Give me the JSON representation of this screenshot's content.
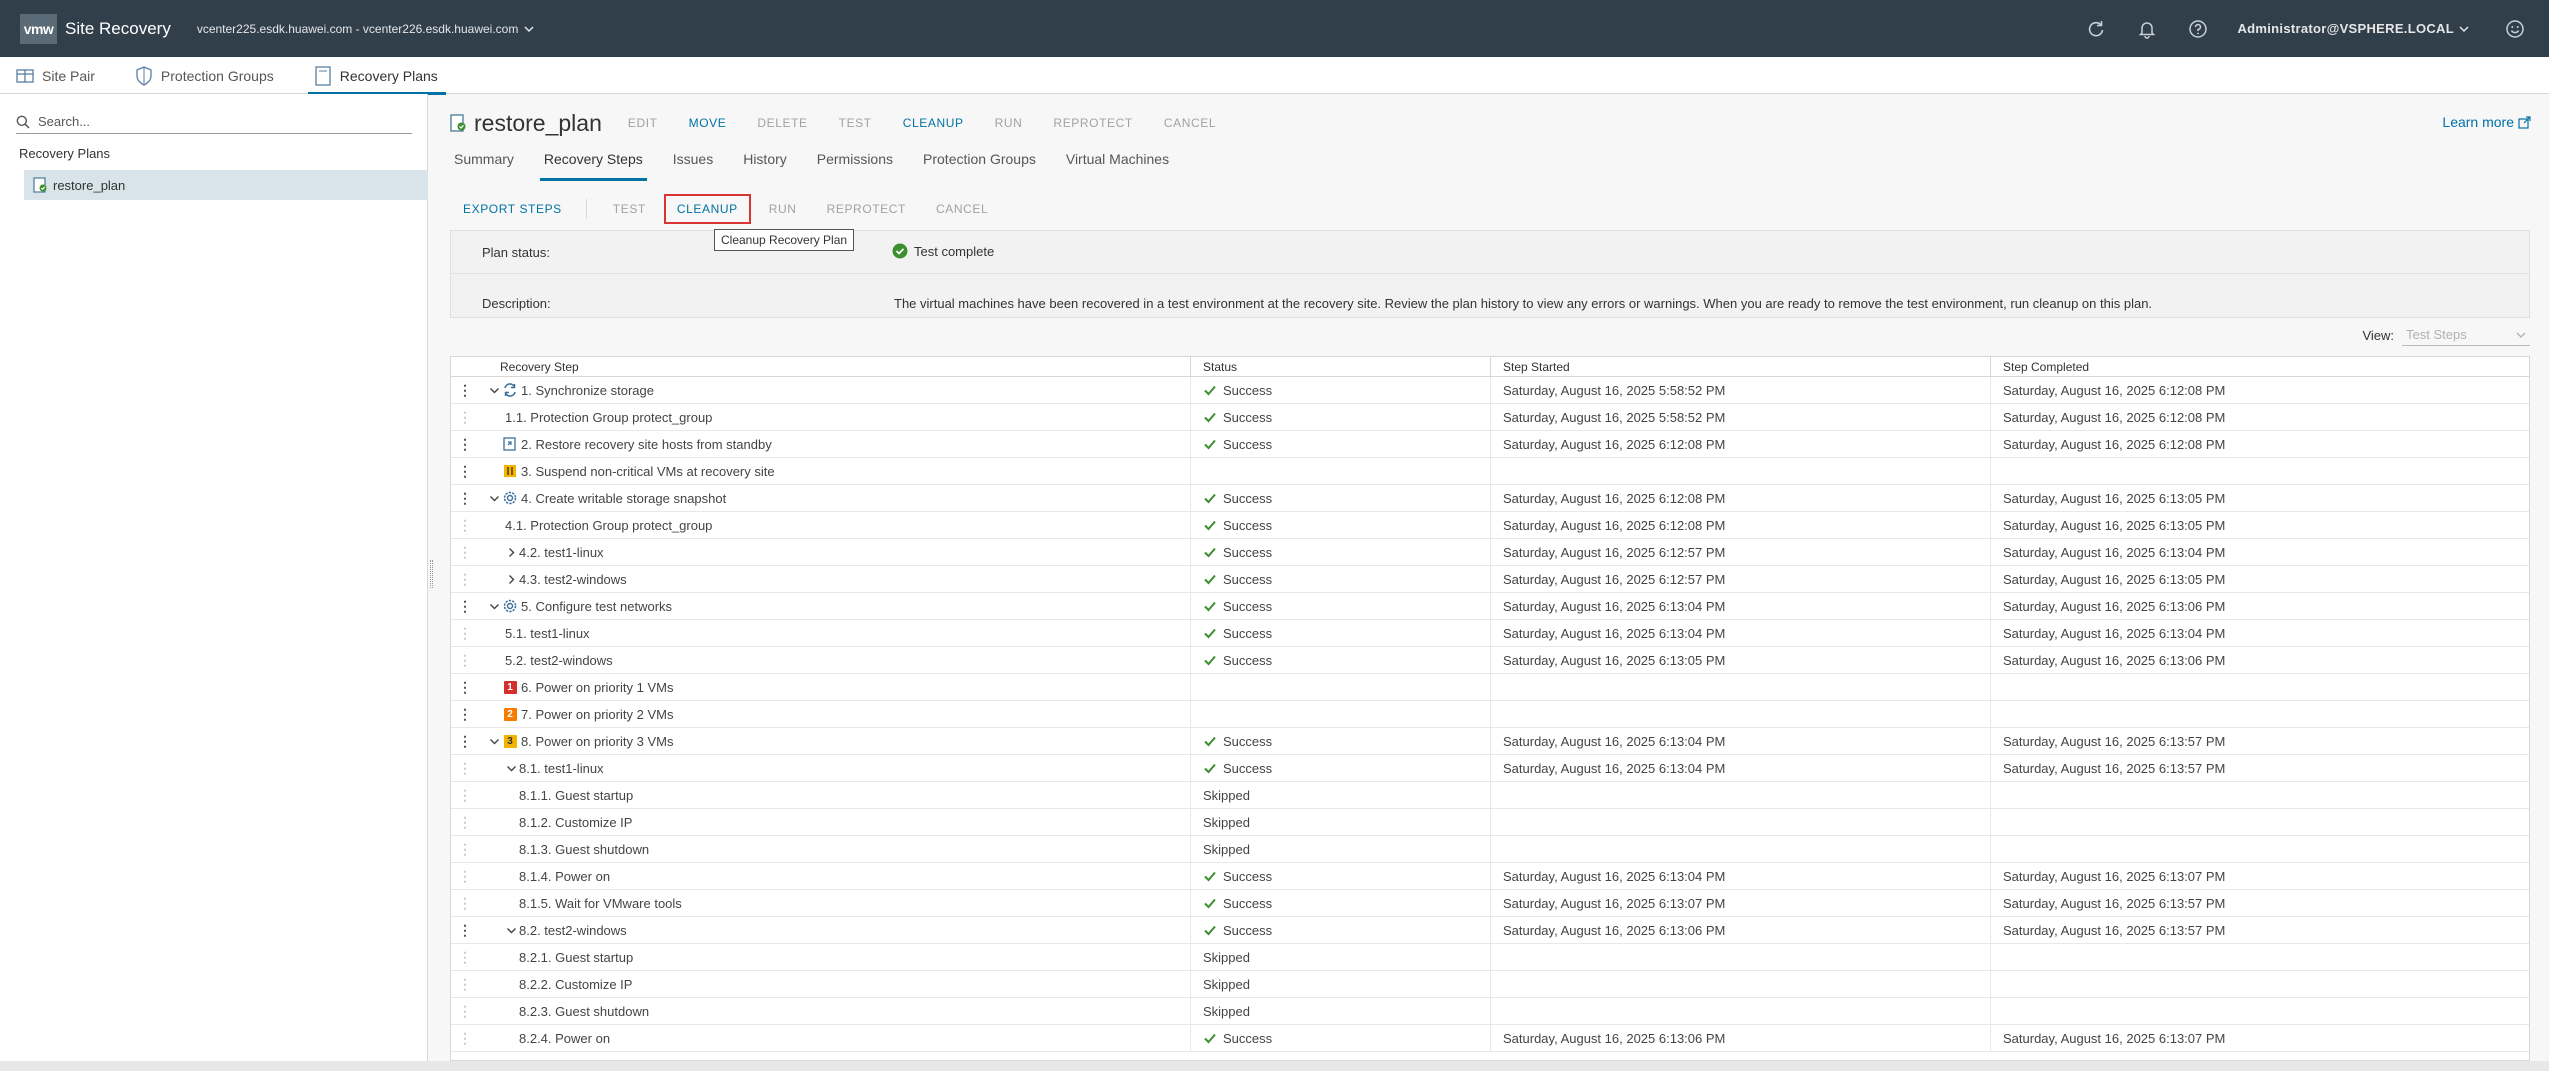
{
  "header": {
    "logo_text": "vmw",
    "app_title": "Site Recovery",
    "vcenter_pair": "vcenter225.esdk.huawei.com - vcenter226.esdk.huawei.com",
    "user": "Administrator@VSPHERE.LOCAL",
    "icons": [
      "refresh-icon",
      "bell-icon",
      "help-icon",
      "smiley-icon"
    ]
  },
  "nav": {
    "items": [
      {
        "label": "Site Pair",
        "icon": "site-pair-icon"
      },
      {
        "label": "Protection Groups",
        "icon": "shield-icon"
      },
      {
        "label": "Recovery Plans",
        "icon": "document-icon"
      }
    ]
  },
  "left": {
    "search_placeholder": "Search...",
    "tree_header": "Recovery Plans",
    "plan_name": "restore_plan"
  },
  "plan": {
    "title": "restore_plan",
    "actions": [
      "EDIT",
      "MOVE",
      "DELETE",
      "TEST",
      "CLEANUP",
      "RUN",
      "REPROTECT",
      "CANCEL"
    ],
    "learn_more": "Learn more"
  },
  "tabs": [
    "Summary",
    "Recovery Steps",
    "Issues",
    "History",
    "Permissions",
    "Protection Groups",
    "Virtual Machines"
  ],
  "steps_toolbar": {
    "export": "EXPORT STEPS",
    "test": "TEST",
    "cleanup": "CLEANUP",
    "run": "RUN",
    "reprotect": "REPROTECT",
    "cancel": "CANCEL",
    "tooltip": "Cleanup Recovery Plan"
  },
  "status_panel": {
    "plan_status_label": "Plan status:",
    "plan_status_value": "Test complete",
    "description_label": "Description:",
    "description_value": "The virtual machines have been recovered in a test environment at the recovery site. Review the plan history to view any errors or warnings. When you are ready to remove the test environment, run cleanup on this plan."
  },
  "view": {
    "label": "View:",
    "value": "Test Steps"
  },
  "grid": {
    "columns": [
      "Recovery Step",
      "Status",
      "Step Started",
      "Step Completed"
    ],
    "rows": [
      {
        "step": "1. Synchronize storage",
        "status": "Success",
        "start": "Saturday, August 16, 2025 5:58:52 PM",
        "end": "Saturday, August 16, 2025 6:12:08 PM"
      },
      {
        "step": "1.1. Protection Group protect_group",
        "status": "Success",
        "start": "Saturday, August 16, 2025 5:58:52 PM",
        "end": "Saturday, August 16, 2025 6:12:08 PM"
      },
      {
        "step": "2. Restore recovery site hosts from standby",
        "status": "Success",
        "start": "Saturday, August 16, 2025 6:12:08 PM",
        "end": "Saturday, August 16, 2025 6:12:08 PM"
      },
      {
        "step": "3. Suspend non-critical VMs at recovery site",
        "status": "",
        "start": "",
        "end": ""
      },
      {
        "step": "4. Create writable storage snapshot",
        "status": "Success",
        "start": "Saturday, August 16, 2025 6:12:08 PM",
        "end": "Saturday, August 16, 2025 6:13:05 PM"
      },
      {
        "step": "4.1. Protection Group protect_group",
        "status": "Success",
        "start": "Saturday, August 16, 2025 6:12:08 PM",
        "end": "Saturday, August 16, 2025 6:13:05 PM"
      },
      {
        "step": "4.2. test1-linux",
        "status": "Success",
        "start": "Saturday, August 16, 2025 6:12:57 PM",
        "end": "Saturday, August 16, 2025 6:13:04 PM"
      },
      {
        "step": "4.3. test2-windows",
        "status": "Success",
        "start": "Saturday, August 16, 2025 6:12:57 PM",
        "end": "Saturday, August 16, 2025 6:13:05 PM"
      },
      {
        "step": "5. Configure test networks",
        "status": "Success",
        "start": "Saturday, August 16, 2025 6:13:04 PM",
        "end": "Saturday, August 16, 2025 6:13:06 PM"
      },
      {
        "step": "5.1. test1-linux",
        "status": "Success",
        "start": "Saturday, August 16, 2025 6:13:04 PM",
        "end": "Saturday, August 16, 2025 6:13:04 PM"
      },
      {
        "step": "5.2. test2-windows",
        "status": "Success",
        "start": "Saturday, August 16, 2025 6:13:05 PM",
        "end": "Saturday, August 16, 2025 6:13:06 PM"
      },
      {
        "step": "6. Power on priority 1 VMs",
        "status": "",
        "start": "",
        "end": ""
      },
      {
        "step": "7. Power on priority 2 VMs",
        "status": "",
        "start": "",
        "end": ""
      },
      {
        "step": "8. Power on priority 3 VMs",
        "status": "Success",
        "start": "Saturday, August 16, 2025 6:13:04 PM",
        "end": "Saturday, August 16, 2025 6:13:57 PM"
      },
      {
        "step": "8.1. test1-linux",
        "status": "Success",
        "start": "Saturday, August 16, 2025 6:13:04 PM",
        "end": "Saturday, August 16, 2025 6:13:57 PM"
      },
      {
        "step": "8.1.1. Guest startup",
        "status": "Skipped",
        "start": "",
        "end": ""
      },
      {
        "step": "8.1.2. Customize IP",
        "status": "Skipped",
        "start": "",
        "end": ""
      },
      {
        "step": "8.1.3. Guest shutdown",
        "status": "Skipped",
        "start": "",
        "end": ""
      },
      {
        "step": "8.1.4. Power on",
        "status": "Success",
        "start": "Saturday, August 16, 2025 6:13:04 PM",
        "end": "Saturday, August 16, 2025 6:13:07 PM"
      },
      {
        "step": "8.1.5. Wait for VMware tools",
        "status": "Success",
        "start": "Saturday, August 16, 2025 6:13:07 PM",
        "end": "Saturday, August 16, 2025 6:13:57 PM"
      },
      {
        "step": "8.2. test2-windows",
        "status": "Success",
        "start": "Saturday, August 16, 2025 6:13:06 PM",
        "end": "Saturday, August 16, 2025 6:13:57 PM"
      },
      {
        "step": "8.2.1. Guest startup",
        "status": "Skipped",
        "start": "",
        "end": ""
      },
      {
        "step": "8.2.2. Customize IP",
        "status": "Skipped",
        "start": "",
        "end": ""
      },
      {
        "step": "8.2.3. Guest shutdown",
        "status": "Skipped",
        "start": "",
        "end": ""
      },
      {
        "step": "8.2.4. Power on",
        "status": "Success",
        "start": "Saturday, August 16, 2025 6:13:06 PM",
        "end": "Saturday, August 16, 2025 6:13:07 PM"
      }
    ]
  },
  "colors": {
    "header_bg": "#313f4b",
    "accent": "#0072a3",
    "success": "#2f8400",
    "priority_1": "#d32f2f",
    "priority_2": "#f57c00",
    "priority_3": "#f2b400",
    "highlight_border": "#d83434"
  }
}
